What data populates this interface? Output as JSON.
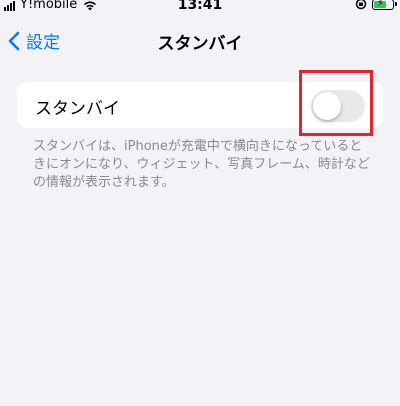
{
  "status_bar": {
    "carrier": "Y!mobile",
    "time": "13:41",
    "battery_fill_fraction": 0.7,
    "battery_color": "#34c759"
  },
  "nav": {
    "back_label": "設定",
    "title": "スタンバイ"
  },
  "settings": {
    "standby_label": "スタンバイ",
    "standby_enabled": false,
    "footer": "スタンバイは、iPhoneが充電中で横向きになっているときにオンになり、ウィジェット、写真フレーム、時計などの情報が表示されます。"
  },
  "colors": {
    "accent": "#007aff",
    "highlight": "#e8212e",
    "background": "#f2f2f7"
  }
}
